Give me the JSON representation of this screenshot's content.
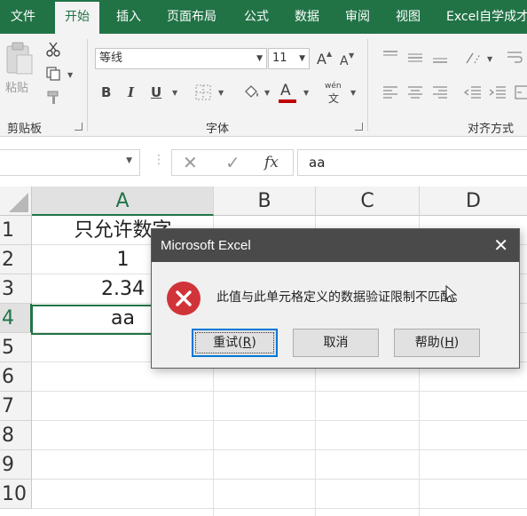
{
  "ribbon": {
    "tabs": [
      {
        "label": "文件"
      },
      {
        "label": "开始",
        "active": true
      },
      {
        "label": "插入"
      },
      {
        "label": "页面布局"
      },
      {
        "label": "公式"
      },
      {
        "label": "数据"
      },
      {
        "label": "审阅"
      },
      {
        "label": "视图"
      },
      {
        "label": "Excel自学成才"
      }
    ],
    "clipboard": {
      "paste_label": "粘贴",
      "group_label": "剪贴板"
    },
    "font": {
      "font_name": "等线",
      "font_size": "11",
      "bold": "B",
      "italic": "I",
      "underline": "U",
      "increase_font": "A",
      "decrease_font": "A",
      "font_color_glyph": "A",
      "font_color": "#c00000",
      "phonetic_glyph": "wén",
      "group_label": "字体"
    },
    "alignment": {
      "group_label": "对齐方式"
    }
  },
  "formula_bar": {
    "name_box": "",
    "cancel_glyph": "✕",
    "enter_glyph": "✓",
    "fx_label": "fx",
    "content": "aa"
  },
  "sheet": {
    "columns": [
      "A",
      "B",
      "C",
      "D"
    ],
    "selected_column": "A",
    "rows": [
      "1",
      "2",
      "3",
      "4",
      "5",
      "6",
      "7",
      "8",
      "9",
      "10"
    ],
    "selected_row": "4",
    "cells": {
      "A1": "只允许数字",
      "A2": "1",
      "A3": "2.34",
      "A4": "aa"
    }
  },
  "dialog": {
    "title": "Microsoft Excel",
    "message": "此值与此单元格定义的数据验证限制不匹配。",
    "retry_label": "重试(",
    "retry_key": "R",
    "cancel_label": "取消",
    "help_label": "帮助(",
    "help_key": "H",
    "close_glyph": "✕",
    "error_color": "#d13438"
  },
  "theme": {
    "accent": "#217346"
  }
}
